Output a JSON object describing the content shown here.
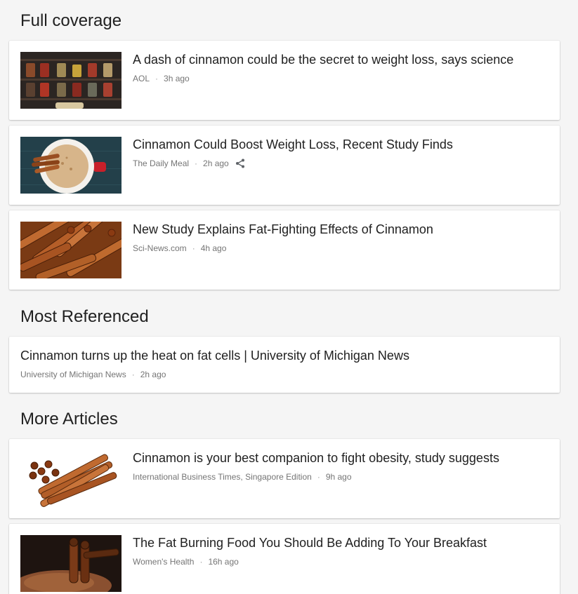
{
  "sections": [
    {
      "title": "Full coverage",
      "articles": [
        {
          "headline": "A dash of cinnamon could be the secret to weight loss, says science",
          "source": "AOL",
          "time": "3h ago",
          "thumbnail": "spice-jars-shelf"
        },
        {
          "headline": "Cinnamon Could Boost Weight Loss, Recent Study Finds",
          "source": "The Daily Meal",
          "time": "2h ago",
          "thumbnail": "cinnamon-latte-mug",
          "share": "share-icon"
        },
        {
          "headline": "New Study Explains Fat-Fighting Effects of Cinnamon",
          "source": "Sci-News.com",
          "time": "4h ago",
          "thumbnail": "cinnamon-sticks-pile"
        }
      ]
    },
    {
      "title": "Most Referenced",
      "articles": [
        {
          "headline": "Cinnamon turns up the heat on fat cells | University of Michigan News",
          "source": "University of Michigan News",
          "time": "2h ago"
        }
      ]
    },
    {
      "title": "More Articles",
      "articles": [
        {
          "headline": "Cinnamon is your best companion to fight obesity, study suggests",
          "source": "International Business Times, Singapore Edition",
          "time": "9h ago",
          "thumbnail": "cinnamon-sticks-bundle"
        },
        {
          "headline": "The Fat Burning Food You Should Be Adding To Your Breakfast",
          "source": "Women's Health",
          "time": "16h ago",
          "thumbnail": "cinnamon-powder-dark"
        }
      ]
    }
  ],
  "colors": {
    "background": "#f5f5f5",
    "card": "#ffffff",
    "headline": "#212121",
    "meta": "#757575"
  }
}
